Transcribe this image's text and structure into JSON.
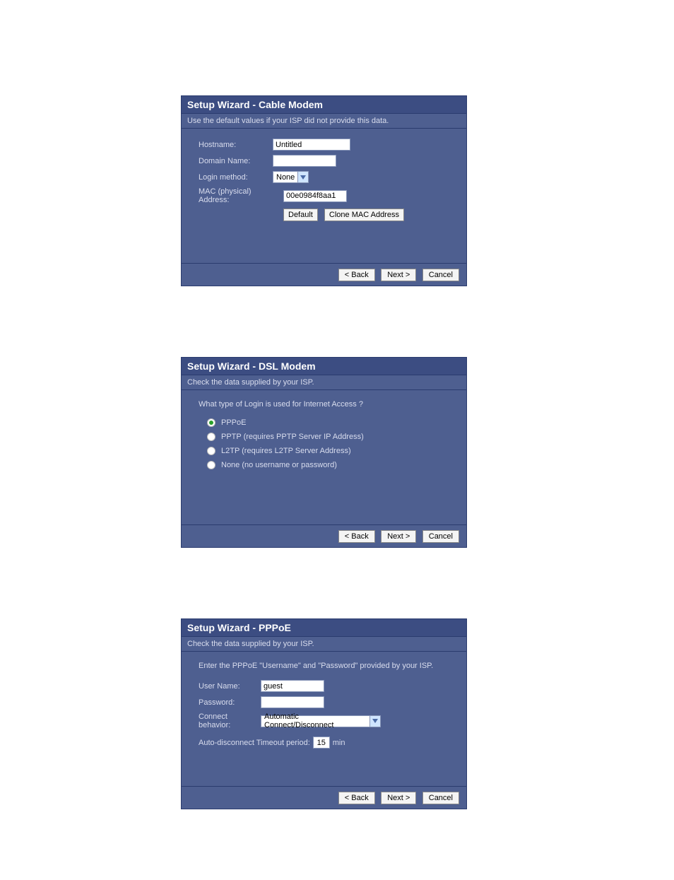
{
  "panel1": {
    "title": "Setup Wizard - Cable Modem",
    "subtitle": "Use the default values if your ISP did not provide this data.",
    "labels": {
      "hostname": "Hostname:",
      "domain": "Domain Name:",
      "login_method": "Login method:",
      "mac": "MAC (physical) Address:"
    },
    "values": {
      "hostname": "Untitled",
      "domain": "",
      "login_method": "None",
      "mac": "00e0984f8aa1"
    },
    "buttons": {
      "default": "Default",
      "clone": "Clone MAC Address"
    }
  },
  "panel2": {
    "title": "Setup Wizard - DSL Modem",
    "subtitle": "Check the data supplied by your ISP.",
    "prompt": "What type of Login is used for Internet Access ?",
    "options": {
      "pppoe": "PPPoE",
      "pptp": "PPTP (requires PPTP Server IP Address)",
      "l2tp": "L2TP (requires L2TP Server Address)",
      "none": "None (no username or password)"
    },
    "selected": "pppoe"
  },
  "panel3": {
    "title": "Setup Wizard - PPPoE",
    "subtitle": "Check the data supplied by your ISP.",
    "prompt": "Enter the PPPoE \"Username\" and \"Password\" provided by your ISP.",
    "labels": {
      "username": "User Name:",
      "password": "Password:",
      "connect": "Connect behavior:",
      "timeout_pre": "Auto-disconnect Timeout period:",
      "timeout_unit": "min"
    },
    "values": {
      "username": "guest",
      "password": "",
      "connect": "Automatic Connect/Disconnect",
      "timeout": "15"
    }
  },
  "footer": {
    "back": "< Back",
    "next": "Next >",
    "cancel": "Cancel"
  }
}
